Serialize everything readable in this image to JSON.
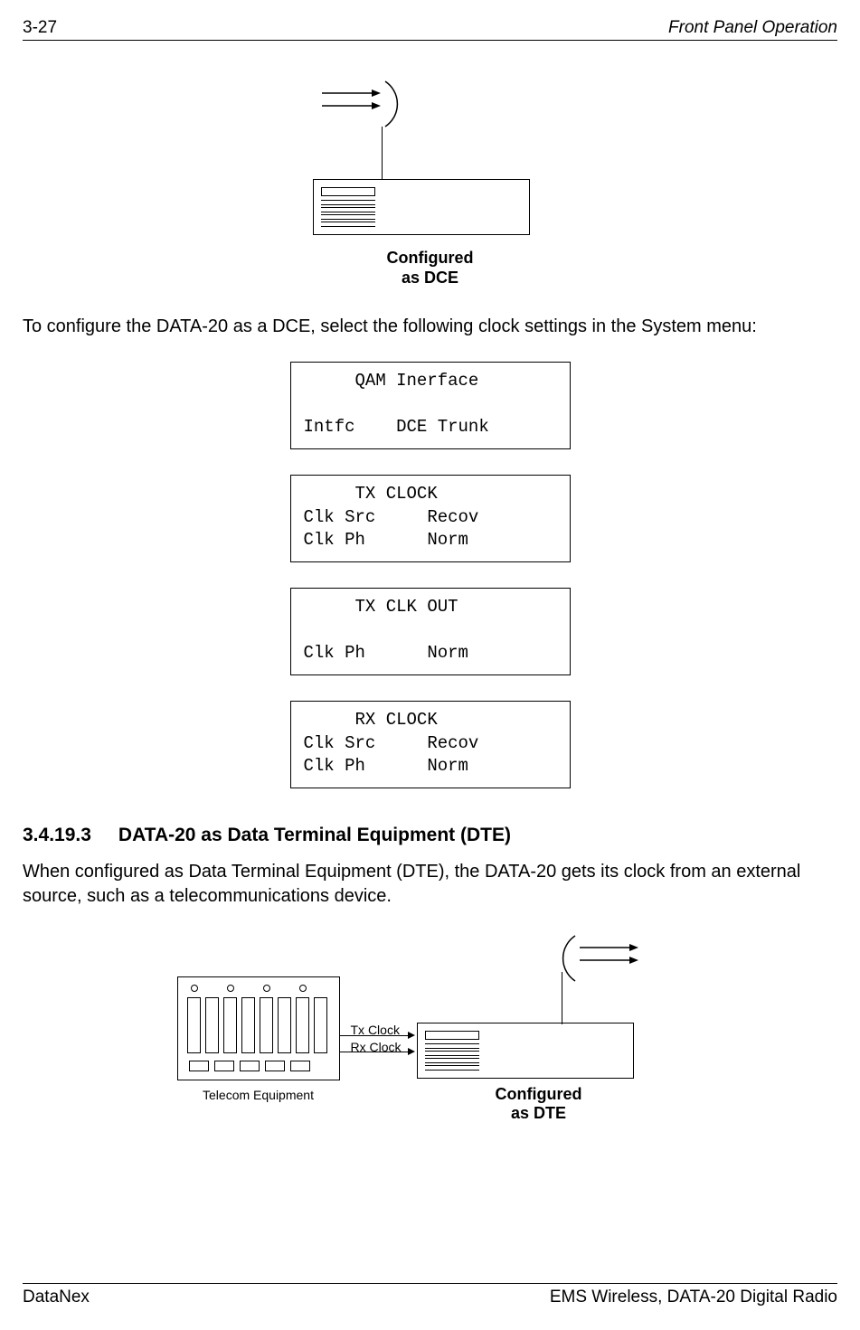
{
  "header": {
    "page_num": "3-27",
    "section": "Front Panel Operation"
  },
  "footer": {
    "left": "DataNex",
    "right": "EMS Wireless, DATA-20 Digital Radio"
  },
  "fig_dce": {
    "caption_line1": "Configured",
    "caption_line2": "as DCE"
  },
  "para1": "To configure the DATA-20 as a DCE, select the following clock settings in the System menu:",
  "lcd": {
    "box1": "     QAM Inerface\n\nIntfc    DCE Trunk",
    "box2": "     TX CLOCK\nClk Src     Recov\nClk Ph      Norm",
    "box3": "     TX CLK OUT\n\nClk Ph      Norm",
    "box4": "     RX CLOCK\nClk Src     Recov\nClk Ph      Norm"
  },
  "subheading": {
    "num": "3.4.19.3",
    "title": "DATA-20 as Data Terminal Equipment (DTE)"
  },
  "para2": "When configured as Data Terminal Equipment (DTE), the DATA-20 gets its clock from an external source, such as a telecommunications device.",
  "fig_dte": {
    "tx": "Tx Clock",
    "rx": "Rx Clock",
    "telecom_caption": "Telecom Equipment",
    "cfg_line1": "Configured",
    "cfg_line2": "as DTE"
  }
}
